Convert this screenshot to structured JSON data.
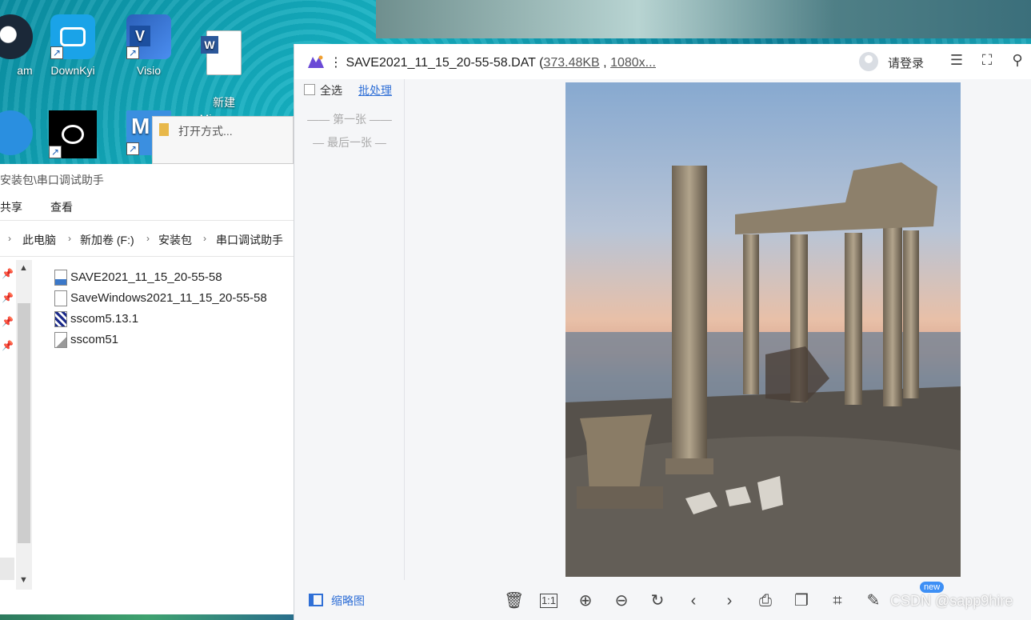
{
  "desktop": {
    "icons": [
      {
        "label": "am"
      },
      {
        "label": "DownKyi"
      },
      {
        "label": "Visio"
      },
      {
        "label": "新建\nMicroso..."
      }
    ]
  },
  "explorer": {
    "path_title": "安装包\\串口调试助手",
    "ribbon": {
      "share": "共享",
      "view": "查看"
    },
    "breadcrumb": [
      "此电脑",
      "新加卷 (F:)",
      "安装包",
      "串口调试助手"
    ],
    "files": [
      {
        "name": "SAVE2021_11_15_20-55-58"
      },
      {
        "name": "SaveWindows2021_11_15_20-55-58"
      },
      {
        "name": "sscom5.13.1"
      },
      {
        "name": "sscom51"
      }
    ]
  },
  "open_dialog": {
    "title": "打开方式..."
  },
  "viewer": {
    "title_prefix": "⋮ SAVE2021_11_15_20-55-58.DAT (",
    "size": "373.48KB",
    "sep": " , ",
    "dims": "1080x...",
    "login": "请登录",
    "select_all": "全选",
    "batch": "批处理",
    "first": "—— 第一张 ——",
    "last": "— 最后一张 —",
    "thumbnails": "缩略图",
    "new_badge": "new",
    "watermark": "CSDN @sapp9hire",
    "colors": {
      "accent": "#2f6fd6",
      "logo": "#6a4ad6"
    }
  }
}
